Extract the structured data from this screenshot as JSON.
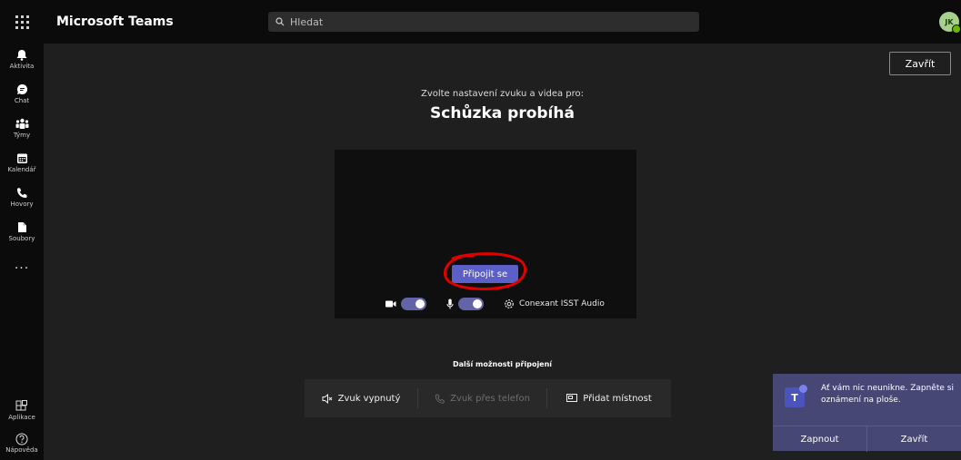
{
  "app": {
    "title": "Microsoft Teams"
  },
  "search": {
    "placeholder": "Hledat"
  },
  "user": {
    "initials": "JK",
    "status_color": "#6bb700"
  },
  "rail": {
    "items": [
      {
        "label": "Aktivita",
        "icon": "bell-icon"
      },
      {
        "label": "Chat",
        "icon": "chat-icon"
      },
      {
        "label": "Týmy",
        "icon": "teams-icon"
      },
      {
        "label": "Kalendář",
        "icon": "calendar-icon"
      },
      {
        "label": "Hovory",
        "icon": "phone-icon"
      },
      {
        "label": "Soubory",
        "icon": "file-icon"
      }
    ],
    "more": "...",
    "bottom": [
      {
        "label": "Aplikace",
        "icon": "apps-icon"
      },
      {
        "label": "Nápověda",
        "icon": "help-icon"
      }
    ]
  },
  "prejoin": {
    "close_label": "Zavřít",
    "subtitle": "Zvolte nastavení zvuku a videa pro:",
    "meeting_title": "Schůzka probíhá",
    "join_label": "Připojit se",
    "camera_on": true,
    "mic_on": true,
    "audio_device": "Conexant ISST Audio",
    "more_options_title": "Další možnosti připojení",
    "options": {
      "audio_off": "Zvuk vypnutý",
      "phone_audio": "Zvuk přes telefon",
      "add_room": "Přidat místnost"
    }
  },
  "toast": {
    "message": "Ať vám nic neunikne. Zapněte si oznámení na ploše.",
    "enable_label": "Zapnout",
    "close_label": "Zavřít"
  },
  "colors": {
    "accent": "#6264a7",
    "join_button": "#5b5fc7",
    "toast_bg": "#464775",
    "annotation": "#e00000"
  }
}
